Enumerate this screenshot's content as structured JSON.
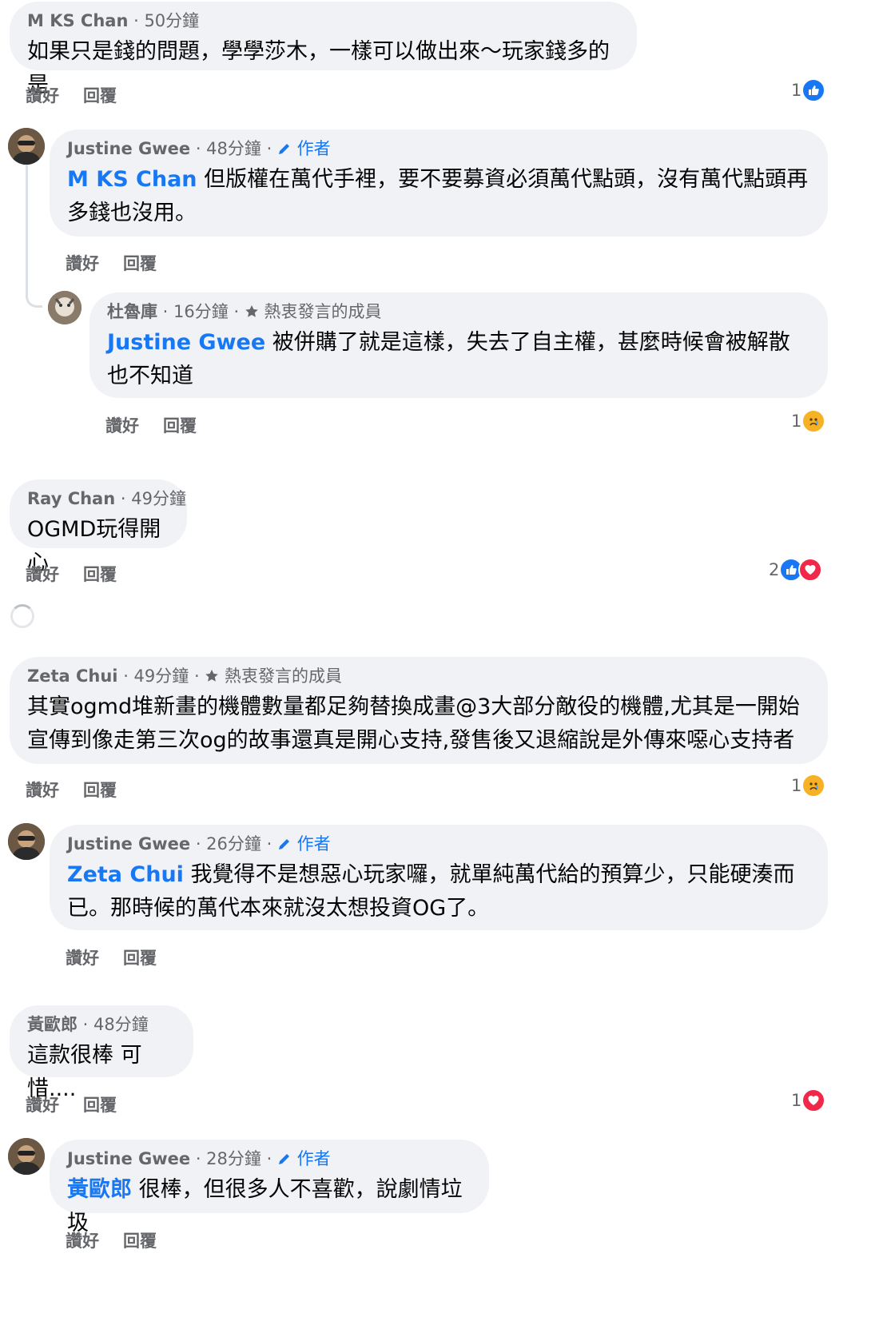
{
  "comments": [
    {
      "author": "M KS Chan",
      "time": "50分鐘",
      "badge": "",
      "mention": "",
      "text": "如果只是錢的問題，學學莎木，一樣可以做出來～玩家錢多的是",
      "like": "讚好",
      "reply": "回覆",
      "reaction_count": "1",
      "reactions": [
        "like"
      ]
    },
    {
      "author": "Justine Gwee",
      "time": "48分鐘",
      "badge": "作者",
      "mention": "M KS Chan",
      "text": " 但版權在萬代手裡，要不要募資必須萬代點頭，沒有萬代點頭再多錢也沒用。",
      "like": "讚好",
      "reply": "回覆",
      "reaction_count": "",
      "reactions": []
    },
    {
      "author": "杜魯庫",
      "time": "16分鐘",
      "badge": "熱衷發言的成員",
      "mention": "Justine Gwee",
      "text": " 被併購了就是這樣，失去了自主權，甚麼時候會被解散也不知道",
      "like": "讚好",
      "reply": "回覆",
      "reaction_count": "1",
      "reactions": [
        "sad"
      ]
    },
    {
      "author": "Ray Chan",
      "time": "49分鐘",
      "badge": "",
      "mention": "",
      "text": "OGMD玩得開心",
      "like": "讚好",
      "reply": "回覆",
      "reaction_count": "2",
      "reactions": [
        "like",
        "love"
      ]
    },
    {
      "author": "Zeta Chui",
      "time": "49分鐘",
      "badge": "熱衷發言的成員",
      "mention": "",
      "text": "其實ogmd堆新畫的機體數量都足夠替換成畫@3大部分敵役的機體,尤其是一開始宣傳到像走第三次og的故事還真是開心支持,發售後又退縮說是外傳來噁心支持者",
      "like": "讚好",
      "reply": "回覆",
      "reaction_count": "1",
      "reactions": [
        "sad"
      ]
    },
    {
      "author": "Justine Gwee",
      "time": "26分鐘",
      "badge": "作者",
      "mention": "Zeta Chui",
      "text": " 我覺得不是想惡心玩家囉，就單純萬代給的預算少，只能硬湊而已。那時候的萬代本來就沒太想投資OG了。",
      "like": "讚好",
      "reply": "回覆",
      "reaction_count": "",
      "reactions": []
    },
    {
      "author": "黃歐郎",
      "time": "48分鐘",
      "badge": "",
      "mention": "",
      "text": "這款很棒 可惜....",
      "like": "讚好",
      "reply": "回覆",
      "reaction_count": "1",
      "reactions": [
        "love"
      ]
    },
    {
      "author": "Justine Gwee",
      "time": "28分鐘",
      "badge": "作者",
      "mention": "黃歐郎",
      "text": " 很棒，但很多人不喜歡，說劇情垃圾",
      "like": "讚好",
      "reply": "回覆",
      "reaction_count": "",
      "reactions": []
    }
  ],
  "colors": {
    "accent": "#1877f2",
    "bubble": "#f0f2f5",
    "muted": "#65676b",
    "love": "#f02849",
    "sad": "#f7b125"
  },
  "icons": {
    "author_badge": "pencil-icon",
    "member_badge": "star-icon",
    "like": "thumbs-up-icon",
    "love": "heart-icon",
    "sad": "sad-face-icon",
    "loading": "spinner-icon"
  }
}
